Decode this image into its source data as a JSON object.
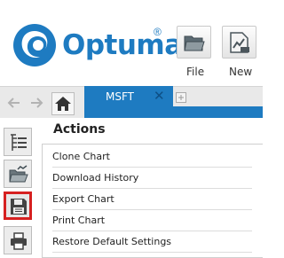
{
  "logo": {
    "text": "Optuma",
    "registered": "®",
    "brand_color": "#1e7bc1"
  },
  "toolbar": {
    "file_label": "File",
    "new_label": "New"
  },
  "tabs": {
    "active_label": "MSFT",
    "close_glyph": "✕",
    "accent": "#1e7bc1"
  },
  "sidebar": {
    "items": [
      {
        "icon": "tree-list-icon"
      },
      {
        "icon": "folder-chart-icon"
      },
      {
        "icon": "save-icon",
        "selected": true,
        "highlight": "#d62020"
      },
      {
        "icon": "printer-icon"
      }
    ]
  },
  "panel": {
    "title": "Actions",
    "items": [
      "Clone Chart",
      "Download History",
      "Export Chart",
      "Print Chart",
      "Restore Default Settings"
    ]
  }
}
